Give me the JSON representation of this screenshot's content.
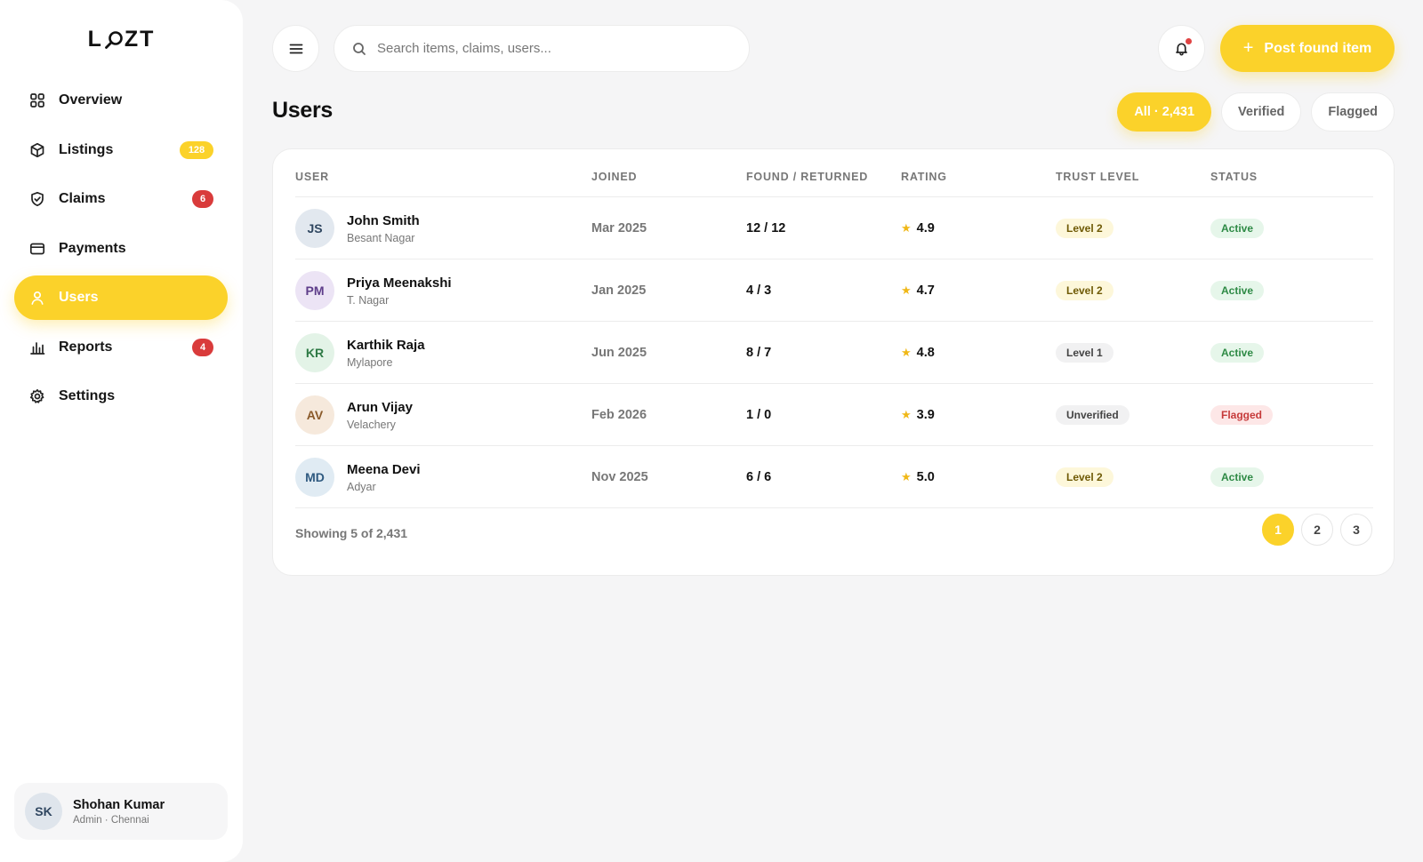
{
  "app": {
    "logo_left": "L",
    "logo_right": "ZT"
  },
  "sidebar": {
    "items": [
      {
        "label": "Overview",
        "icon": "grid-icon",
        "badge": ""
      },
      {
        "label": "Listings",
        "icon": "box-icon",
        "badge": "128"
      },
      {
        "label": "Claims",
        "icon": "shield-check-icon",
        "badge": "6"
      },
      {
        "label": "Payments",
        "icon": "credit-card-icon",
        "badge": ""
      },
      {
        "label": "Users",
        "icon": "user-icon",
        "badge": "",
        "active": true
      },
      {
        "label": "Reports",
        "icon": "bar-chart-icon",
        "badge": "4"
      },
      {
        "label": "Settings",
        "icon": "gear-icon",
        "badge": ""
      }
    ],
    "profile": {
      "initials": "SK",
      "name": "Shohan Kumar",
      "role": "Admin · Chennai"
    }
  },
  "topbar": {
    "search_placeholder": "Search items, claims, users...",
    "post_button": "Post found item"
  },
  "page": {
    "title": "Users",
    "filters": [
      "All · 2,431",
      "Verified",
      "Flagged"
    ]
  },
  "table": {
    "columns": [
      "USER",
      "JOINED",
      "FOUND / RETURNED",
      "RATING",
      "TRUST LEVEL",
      "STATUS"
    ],
    "rows": [
      {
        "initials": "JS",
        "name": "John Smith",
        "location": "Besant Nagar",
        "joined": "Mar 2025",
        "found_returned": "12 / 12",
        "rating": "4.9",
        "trust": "Level 2",
        "status": "Active"
      },
      {
        "initials": "PM",
        "name": "Priya Meenakshi",
        "location": "T. Nagar",
        "joined": "Jan 2025",
        "found_returned": "4 / 3",
        "rating": "4.7",
        "trust": "Level 2",
        "status": "Active"
      },
      {
        "initials": "KR",
        "name": "Karthik Raja",
        "location": "Mylapore",
        "joined": "Jun 2025",
        "found_returned": "8 / 7",
        "rating": "4.8",
        "trust": "Level 1",
        "status": "Active"
      },
      {
        "initials": "AV",
        "name": "Arun Vijay",
        "location": "Velachery",
        "joined": "Feb 2026",
        "found_returned": "1 / 0",
        "rating": "3.9",
        "trust": "Unverified",
        "status": "Flagged"
      },
      {
        "initials": "MD",
        "name": "Meena Devi",
        "location": "Adyar",
        "joined": "Nov 2025",
        "found_returned": "6 / 6",
        "rating": "5.0",
        "trust": "Level 2",
        "status": "Active"
      }
    ],
    "showing": "Showing 5 of 2,431",
    "pages": [
      "1",
      "2",
      "3"
    ]
  },
  "colors": {
    "accent": "#fbd22a",
    "danger": "#d93b3b",
    "success": "#2e8a45"
  }
}
